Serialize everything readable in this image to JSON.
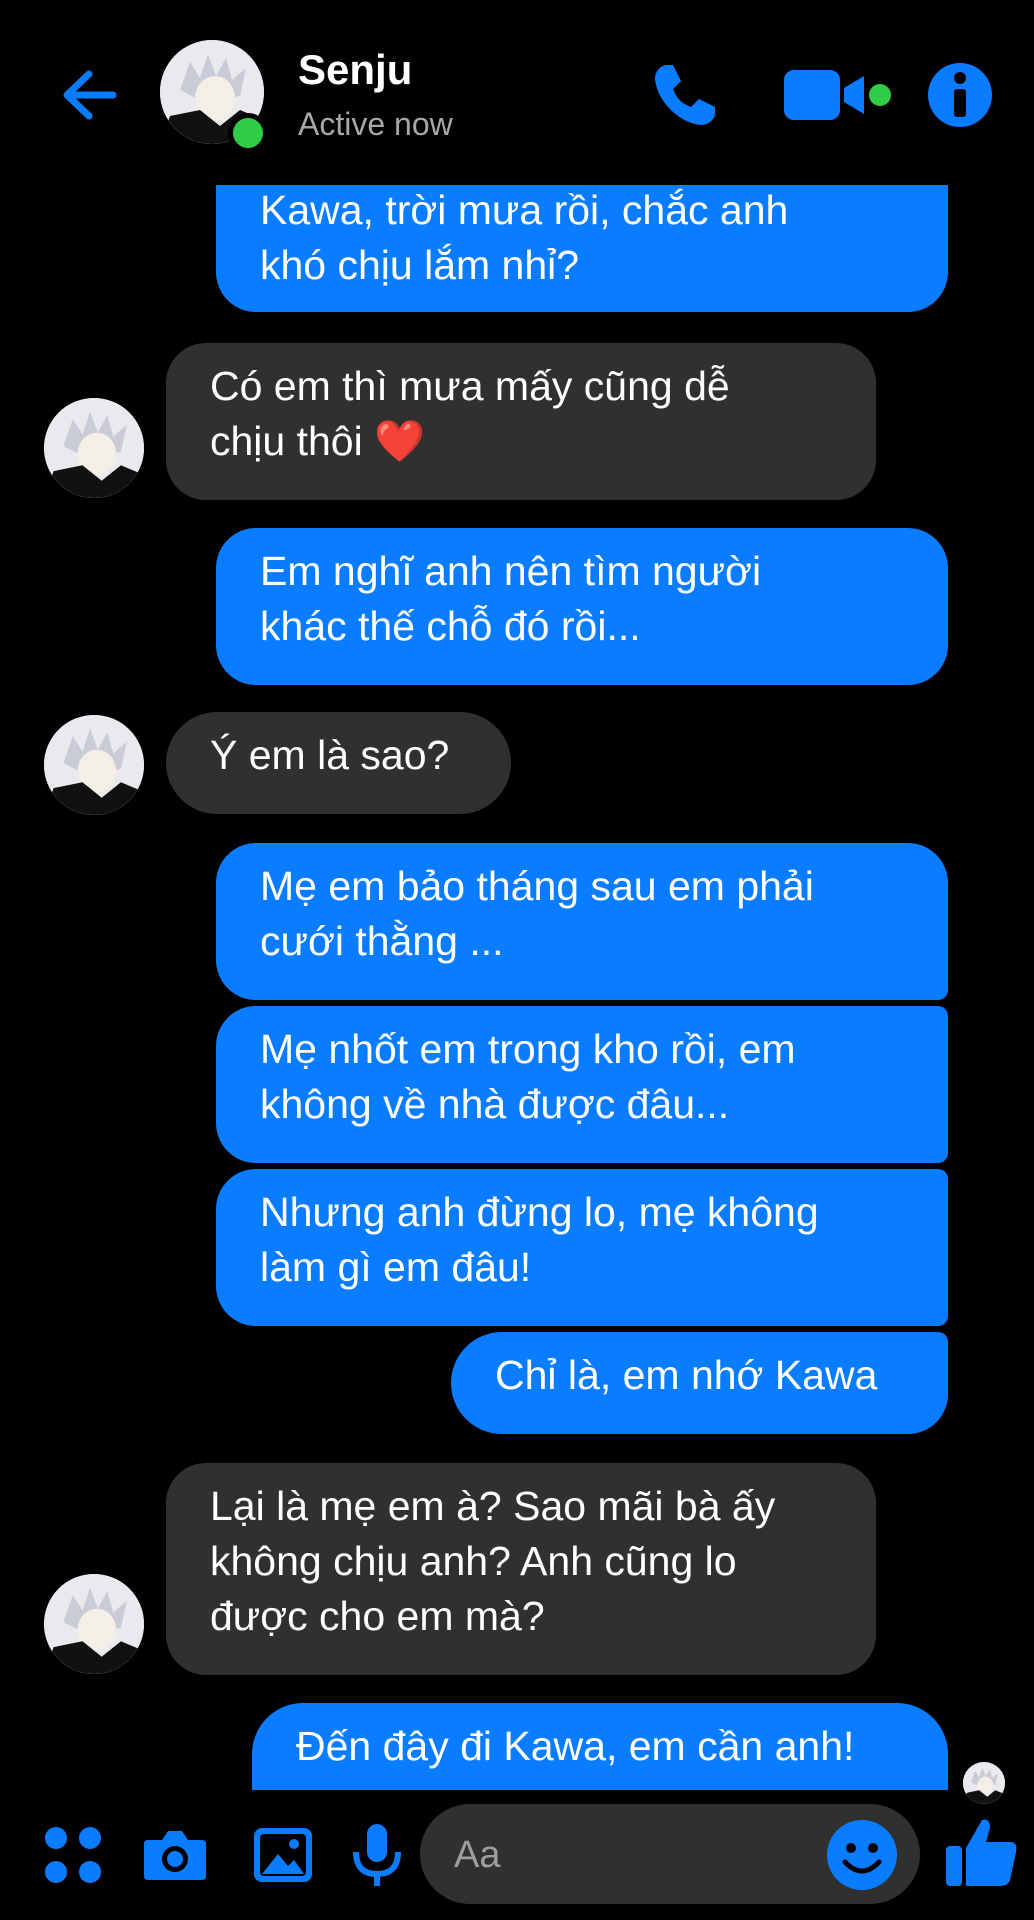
{
  "header": {
    "contact_name": "Senju",
    "status": "Active now",
    "icons": [
      "back-arrow-icon",
      "phone-icon",
      "video-camera-icon",
      "info-icon"
    ],
    "accent_color": "#0a7cff",
    "online_color": "#31cc46"
  },
  "messages": [
    {
      "sender": "me",
      "text": "Kawa, trời mưa rồi, chắc anh khó chịu lắm nhỉ?"
    },
    {
      "sender": "them",
      "text": "Có em thì mưa mấy cũng dễ chịu thôi ❤️"
    },
    {
      "sender": "me",
      "text": "Em nghĩ anh nên tìm người khác thế chỗ đó rồi..."
    },
    {
      "sender": "them",
      "text": "Ý em là sao?"
    },
    {
      "sender": "me",
      "text": "Mẹ em bảo tháng sau em phải cưới thằng ..."
    },
    {
      "sender": "me",
      "text": "Mẹ nhốt em trong kho rồi, em không về nhà được đâu..."
    },
    {
      "sender": "me",
      "text": "Nhưng anh đừng lo, mẹ không làm gì em đâu!"
    },
    {
      "sender": "me",
      "text": "Chỉ là, em nhớ Kawa"
    },
    {
      "sender": "them",
      "text": "Lại là mẹ em à? Sao mãi bà ấy không chịu anh? Anh cũng lo được cho em mà?"
    },
    {
      "sender": "me",
      "text": "Đến đây đi Kawa, em cần anh!"
    }
  ],
  "composer": {
    "placeholder": "Aa",
    "icons": [
      "apps-grid-icon",
      "camera-icon",
      "gallery-icon",
      "microphone-icon",
      "emoji-icon",
      "thumbs-up-icon"
    ]
  },
  "colors": {
    "outgoing_bubble": "#0a7cff",
    "incoming_bubble": "#303030",
    "background": "#000000"
  }
}
